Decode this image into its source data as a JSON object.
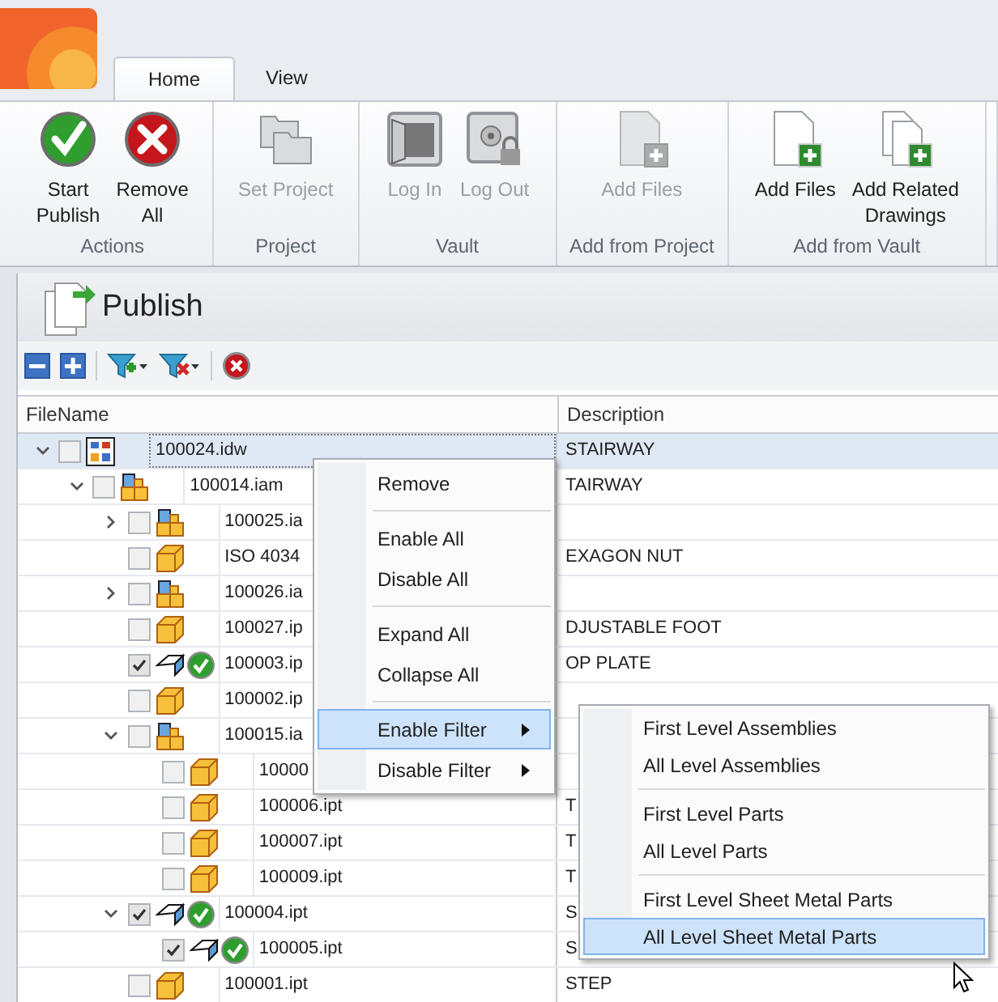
{
  "tabs": [
    {
      "label": "Home",
      "selected": true
    },
    {
      "label": "View",
      "selected": false
    }
  ],
  "ribbon": {
    "groups": [
      {
        "label": "Actions",
        "buttons": [
          {
            "kind": "publish",
            "label": "Start\nPublish",
            "disabled": false
          },
          {
            "kind": "remove",
            "label": "Remove\nAll",
            "disabled": false
          }
        ]
      },
      {
        "label": "Project",
        "buttons": [
          {
            "kind": "project",
            "label": "Set Project",
            "disabled": true
          }
        ]
      },
      {
        "label": "Vault",
        "buttons": [
          {
            "kind": "login",
            "label": "Log In",
            "disabled": true
          },
          {
            "kind": "logout",
            "label": "Log Out",
            "disabled": true
          }
        ]
      },
      {
        "label": "Add from Project",
        "buttons": [
          {
            "kind": "add",
            "label": "Add Files",
            "disabled": true
          }
        ]
      },
      {
        "label": "Add from Vault",
        "buttons": [
          {
            "kind": "add",
            "label": "Add Files",
            "disabled": false
          },
          {
            "kind": "add-related",
            "label": "Add Related\nDrawings",
            "disabled": false
          }
        ]
      }
    ]
  },
  "panel": {
    "title": "Publish"
  },
  "table": {
    "columns": [
      "FileName",
      "Description"
    ],
    "rows": [
      {
        "name": "100024.idw",
        "description": "STAIRWAY",
        "kind": "drawing",
        "checked": false,
        "ok": false,
        "selected": true,
        "expanded": true,
        "children": [
          {
            "name": "100014.iam",
            "description": "TAIRWAY",
            "kind": "assembly",
            "checked": false,
            "ok": false,
            "selected": false,
            "expanded": true,
            "children": [
              {
                "name": "100025.ia",
                "kind": "assembly",
                "checked": false,
                "ok": false,
                "selected": false,
                "expanded": false
              },
              {
                "name": "ISO 4034",
                "description": "EXAGON NUT",
                "kind": "part",
                "checked": false,
                "ok": false,
                "selected": false
              },
              {
                "name": "100026.ia",
                "kind": "assembly",
                "checked": false,
                "ok": false,
                "selected": false,
                "expanded": false
              },
              {
                "name": "100027.ip",
                "description": "DJUSTABLE FOOT",
                "kind": "part",
                "checked": false,
                "ok": false,
                "selected": false
              },
              {
                "name": "100003.ip",
                "description": "OP PLATE",
                "kind": "sheet-metal",
                "checked": true,
                "ok": true,
                "selected": false
              },
              {
                "name": "100002.ip",
                "kind": "part",
                "checked": false,
                "ok": false,
                "selected": false
              },
              {
                "name": "100015.ia",
                "kind": "assembly",
                "checked": false,
                "ok": false,
                "selected": false,
                "expanded": true,
                "children": [
                  {
                    "name": "10000",
                    "kind": "part",
                    "checked": false,
                    "ok": false,
                    "selected": false
                  },
                  {
                    "name": "100006.ipt",
                    "description": "T",
                    "kind": "part",
                    "checked": false,
                    "ok": false,
                    "selected": false
                  },
                  {
                    "name": "100007.ipt",
                    "description": "T",
                    "kind": "part",
                    "checked": false,
                    "ok": false,
                    "selected": false
                  },
                  {
                    "name": "100009.ipt",
                    "description": "T",
                    "kind": "part",
                    "checked": false,
                    "ok": false,
                    "selected": false
                  }
                ]
              },
              {
                "name": "100004.ipt",
                "description": "S",
                "kind": "sheet-metal",
                "checked": true,
                "ok": true,
                "selected": false,
                "expanded": true,
                "children": [
                  {
                    "name": "100005.ipt",
                    "description": "S",
                    "kind": "sheet-metal",
                    "checked": true,
                    "ok": true,
                    "selected": false
                  }
                ]
              },
              {
                "name": "100001.ipt",
                "description": "STEP",
                "kind": "part",
                "checked": false,
                "ok": false,
                "selected": false
              }
            ]
          }
        ]
      }
    ]
  },
  "context_menu": {
    "items": [
      {
        "kind": "item",
        "label": "Remove",
        "selected": false
      },
      {
        "kind": "separator"
      },
      {
        "kind": "item",
        "label": "Enable All",
        "selected": false
      },
      {
        "kind": "item",
        "label": "Disable All",
        "selected": false
      },
      {
        "kind": "separator"
      },
      {
        "kind": "item",
        "label": "Expand All",
        "selected": false
      },
      {
        "kind": "item",
        "label": "Collapse All",
        "selected": false
      },
      {
        "kind": "separator"
      },
      {
        "kind": "submenu",
        "label": "Enable Filter",
        "selected": true
      },
      {
        "kind": "submenu",
        "label": "Disable Filter",
        "selected": false
      }
    ]
  },
  "submenu": {
    "items": [
      {
        "kind": "item",
        "label": "First Level Assemblies",
        "selected": false
      },
      {
        "kind": "item",
        "label": "All Level Assemblies",
        "selected": false
      },
      {
        "kind": "separator"
      },
      {
        "kind": "item",
        "label": "First Level Parts",
        "selected": false
      },
      {
        "kind": "item",
        "label": "All Level Parts",
        "selected": false
      },
      {
        "kind": "separator"
      },
      {
        "kind": "item",
        "label": "First Level Sheet Metal Parts",
        "selected": false
      },
      {
        "kind": "item",
        "label": "All Level Sheet Metal Parts",
        "selected": true
      }
    ]
  }
}
